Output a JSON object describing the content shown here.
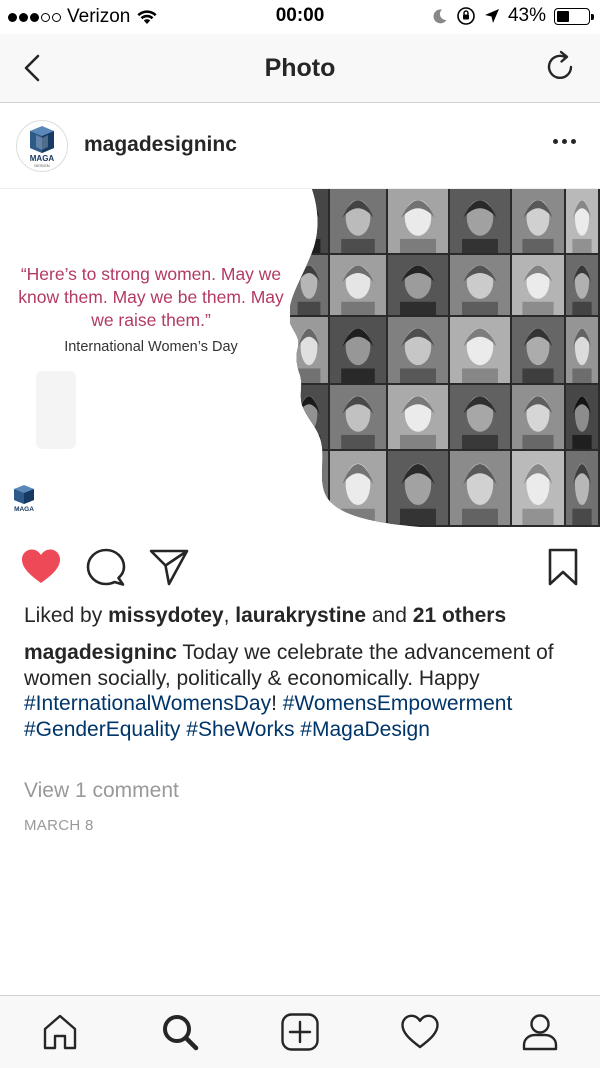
{
  "status_bar": {
    "carrier": "Verizon",
    "time": "00:00",
    "battery_percent": "43%",
    "battery_level": 0.43,
    "signal_bars_filled": 3,
    "signal_bars_total": 5
  },
  "nav": {
    "title": "Photo"
  },
  "post": {
    "username": "magadesigninc",
    "avatar_logo_text": "MAGA",
    "avatar_logo_subtext": "DESIGN",
    "image": {
      "quote": "“Here’s to strong women. May we know them. May we be them. May we raise them.”",
      "subtitle": "International Women’s Day",
      "logo_text": "MAGA"
    },
    "liked": true,
    "likes": {
      "prefix": "Liked by ",
      "user1": "missydotey",
      "separator": ", ",
      "user2": "laurakrystine",
      "and": " and ",
      "others": "21 others"
    },
    "caption": {
      "username": "magadesigninc",
      "text": " Today we celebrate the advancement of women socially, politically & economically. Happy ",
      "tag1": "#InternationalWomensDay",
      "after_tag1": "! ",
      "tag2": "#WomensEmpowerment",
      "tag3": "#GenderEquality",
      "tag4": "#SheWorks",
      "tag5": "#MagaDesign"
    },
    "view_comments": "View 1 comment",
    "date": "MARCH 8"
  },
  "colors": {
    "like_red": "#ed4956",
    "hashtag_blue": "#003569",
    "quote_pink": "#b33a62",
    "muted_gray": "#999999"
  },
  "tab_bar": {
    "icons": [
      "home-icon",
      "search-icon",
      "add-icon",
      "activity-heart-icon",
      "profile-icon"
    ]
  }
}
